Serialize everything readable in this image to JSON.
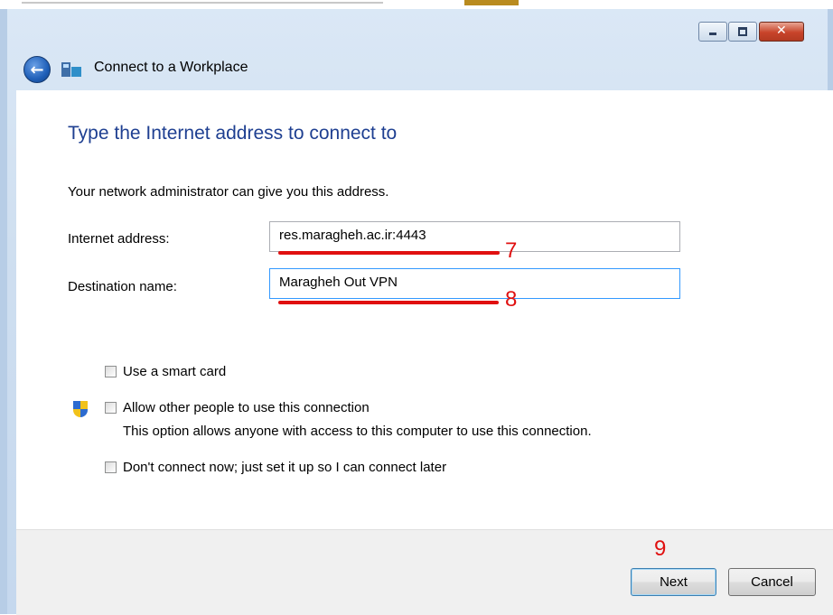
{
  "window": {
    "title": "Connect to a Workplace",
    "controls": {
      "minimize": "minimize-icon",
      "maximize": "maximize-icon",
      "close": "close-icon"
    }
  },
  "page": {
    "heading": "Type the Internet address to connect to",
    "description": "Your network administrator can give you this address."
  },
  "form": {
    "internet_address": {
      "label": "Internet address:",
      "value": "res.maragheh.ac.ir:4443"
    },
    "destination_name": {
      "label": "Destination name:",
      "value": "Maragheh Out VPN"
    }
  },
  "options": {
    "smart_card": {
      "label": "Use a smart card",
      "checked": false
    },
    "allow_others": {
      "label": "Allow other people to use this connection",
      "note": "This option allows anyone with access to this computer to use this connection.",
      "checked": false
    },
    "dont_connect": {
      "label": "Don't connect now; just set it up so I can connect later",
      "checked": false
    }
  },
  "annotations": {
    "step7": "7",
    "step8": "8",
    "step9": "9",
    "color": "#e01010"
  },
  "buttons": {
    "next": "Next",
    "cancel": "Cancel"
  }
}
